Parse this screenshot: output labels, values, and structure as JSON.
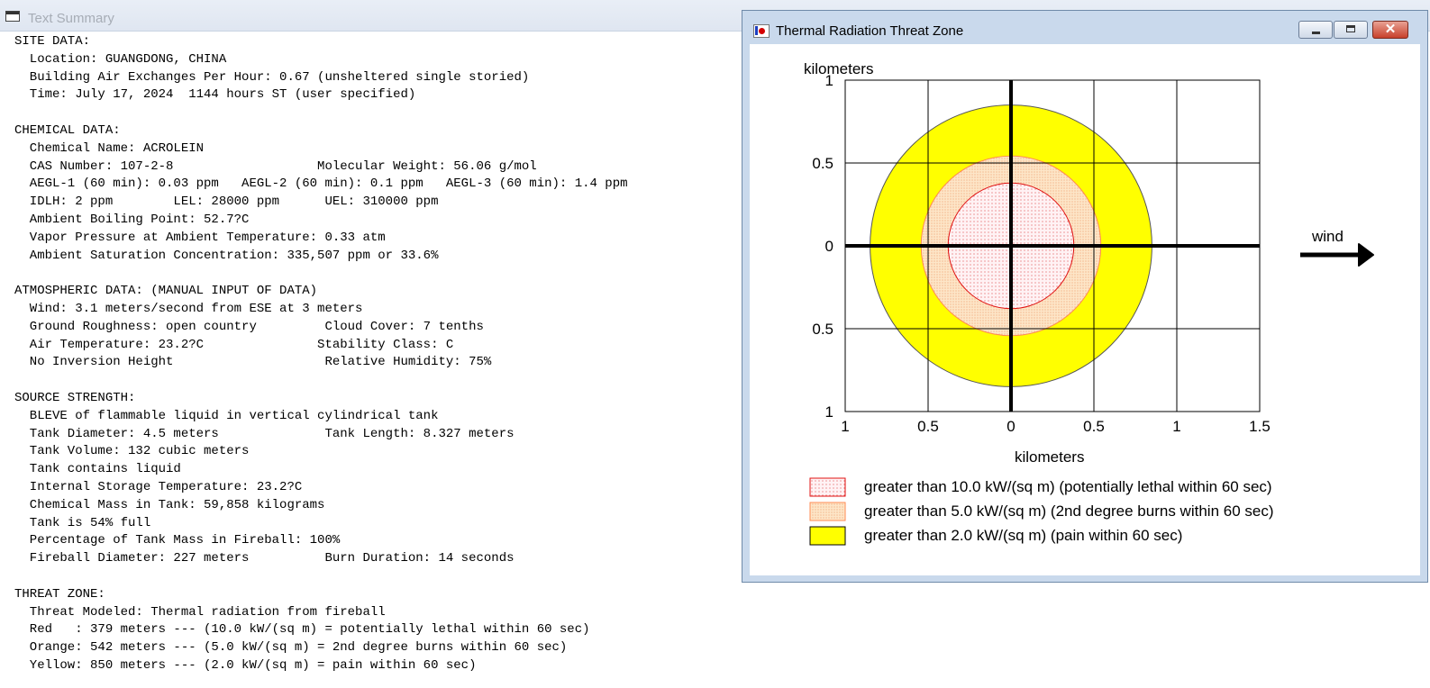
{
  "text_summary": {
    "window_title": "Text Summary",
    "lines": [
      "SITE DATA:",
      "  Location: GUANGDONG, CHINA",
      "  Building Air Exchanges Per Hour: 0.67 (unsheltered single storied)",
      "  Time: July 17, 2024  1144 hours ST (user specified)",
      "",
      "CHEMICAL DATA:",
      "  Chemical Name: ACROLEIN",
      "  CAS Number: 107-2-8                   Molecular Weight: 56.06 g/mol",
      "  AEGL-1 (60 min): 0.03 ppm   AEGL-2 (60 min): 0.1 ppm   AEGL-3 (60 min): 1.4 ppm",
      "  IDLH: 2 ppm        LEL: 28000 ppm      UEL: 310000 ppm",
      "  Ambient Boiling Point: 52.7?C",
      "  Vapor Pressure at Ambient Temperature: 0.33 atm",
      "  Ambient Saturation Concentration: 335,507 ppm or 33.6%",
      "",
      "ATMOSPHERIC DATA: (MANUAL INPUT OF DATA)",
      "  Wind: 3.1 meters/second from ESE at 3 meters",
      "  Ground Roughness: open country         Cloud Cover: 7 tenths",
      "  Air Temperature: 23.2?C               Stability Class: C",
      "  No Inversion Height                    Relative Humidity: 75%",
      "",
      "SOURCE STRENGTH:",
      "  BLEVE of flammable liquid in vertical cylindrical tank",
      "  Tank Diameter: 4.5 meters              Tank Length: 8.327 meters",
      "  Tank Volume: 132 cubic meters",
      "  Tank contains liquid",
      "  Internal Storage Temperature: 23.2?C",
      "  Chemical Mass in Tank: 59,858 kilograms",
      "  Tank is 54% full",
      "  Percentage of Tank Mass in Fireball: 100%",
      "  Fireball Diameter: 227 meters          Burn Duration: 14 seconds",
      "",
      "THREAT ZONE:",
      "  Threat Modeled: Thermal radiation from fireball",
      "  Red   : 379 meters --- (10.0 kW/(sq m) = potentially lethal within 60 sec)",
      "  Orange: 542 meters --- (5.0 kW/(sq m) = 2nd degree burns within 60 sec)",
      "  Yellow: 850 meters --- (2.0 kW/(sq m) = pain within 60 sec)"
    ]
  },
  "threat_window": {
    "title": "Thermal Radiation Threat Zone",
    "buttons": {
      "minimize": "minimize",
      "maximize": "maximize",
      "close": "✕"
    }
  },
  "chart_data": {
    "type": "threat-zone-map",
    "y_unit_label": "kilometers",
    "x_unit_label": "kilometers",
    "x_ticks": [
      "1",
      "0.5",
      "0",
      "0.5",
      "1",
      "1.5"
    ],
    "x_tick_values": [
      -1,
      -0.5,
      0,
      0.5,
      1,
      1.5
    ],
    "y_ticks": [
      "1",
      "0.5",
      "0",
      "0.5",
      "1"
    ],
    "y_tick_values": [
      1,
      0.5,
      0,
      -0.5,
      -1
    ],
    "xlim": [
      -1,
      1.5
    ],
    "ylim": [
      -1,
      1
    ],
    "grid": true,
    "wind_label": "wind",
    "zones": [
      {
        "name": "yellow",
        "radius_km": 0.85,
        "fill": "#ffff00",
        "stroke": "#555555",
        "legend": "greater than 2.0 kW/(sq m) (pain within 60 sec)"
      },
      {
        "name": "orange",
        "radius_km": 0.542,
        "fill": "#fbe0c0",
        "stroke": "#ff8a50",
        "legend": "greater than 5.0 kW/(sq m) (2nd degree burns within 60 sec)"
      },
      {
        "name": "red",
        "radius_km": 0.379,
        "fill": "#fde8ec",
        "stroke": "#e01010",
        "legend": "greater than 10.0 kW/(sq m) (potentially lethal within 60 sec)"
      }
    ],
    "legend_order": [
      "red",
      "orange",
      "yellow"
    ]
  }
}
